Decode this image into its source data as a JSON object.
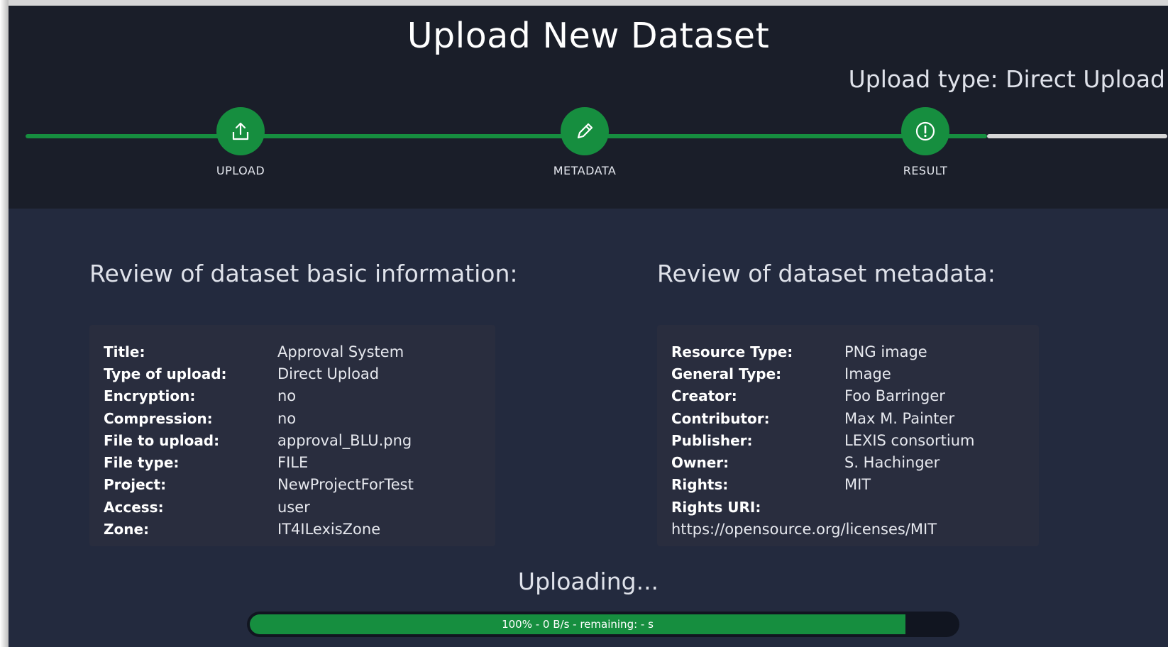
{
  "header": {
    "title": "Upload New Dataset",
    "upload_type": "Upload type: Direct Upload"
  },
  "stepper": {
    "steps": [
      {
        "label": "UPLOAD",
        "icon": "upload-icon"
      },
      {
        "label": "METADATA",
        "icon": "pencil-icon"
      },
      {
        "label": "RESULT",
        "icon": "exclamation-circle-icon"
      }
    ],
    "active_step": 3,
    "colors": {
      "complete": "#168e3f",
      "pending": "#d7d7d7"
    }
  },
  "basic_info": {
    "heading": "Review of dataset basic information:",
    "rows": [
      {
        "label": "Title:",
        "value": "Approval System"
      },
      {
        "label": "Type of upload:",
        "value": "Direct Upload"
      },
      {
        "label": "Encryption:",
        "value": "no"
      },
      {
        "label": "Compression:",
        "value": "no"
      },
      {
        "label": "File to upload:",
        "value": "approval_BLU.png"
      },
      {
        "label": "File type:",
        "value": "FILE"
      },
      {
        "label": "Project:",
        "value": "NewProjectForTest"
      },
      {
        "label": "Access:",
        "value": "user"
      },
      {
        "label": "Zone:",
        "value": "IT4ILexisZone"
      }
    ]
  },
  "metadata": {
    "heading": "Review of dataset metadata:",
    "rows": [
      {
        "label": "Resource Type:",
        "value": "PNG image"
      },
      {
        "label": "General Type:",
        "value": "Image"
      },
      {
        "label": "Creator:",
        "value": "Foo Barringer"
      },
      {
        "label": "Contributor:",
        "value": "Max M. Painter"
      },
      {
        "label": "Publisher:",
        "value": "LEXIS consortium"
      },
      {
        "label": "Owner:",
        "value": "S. Hachinger"
      },
      {
        "label": "Rights:",
        "value": "MIT"
      },
      {
        "label": "Rights URI:",
        "value": ""
      }
    ],
    "rights_uri_value": "https://opensource.org/licenses/MIT"
  },
  "upload_status": {
    "heading": "Uploading...",
    "progress_fraction": 1.0,
    "progress_text": "100% - 0 B/s - remaining: - s"
  }
}
